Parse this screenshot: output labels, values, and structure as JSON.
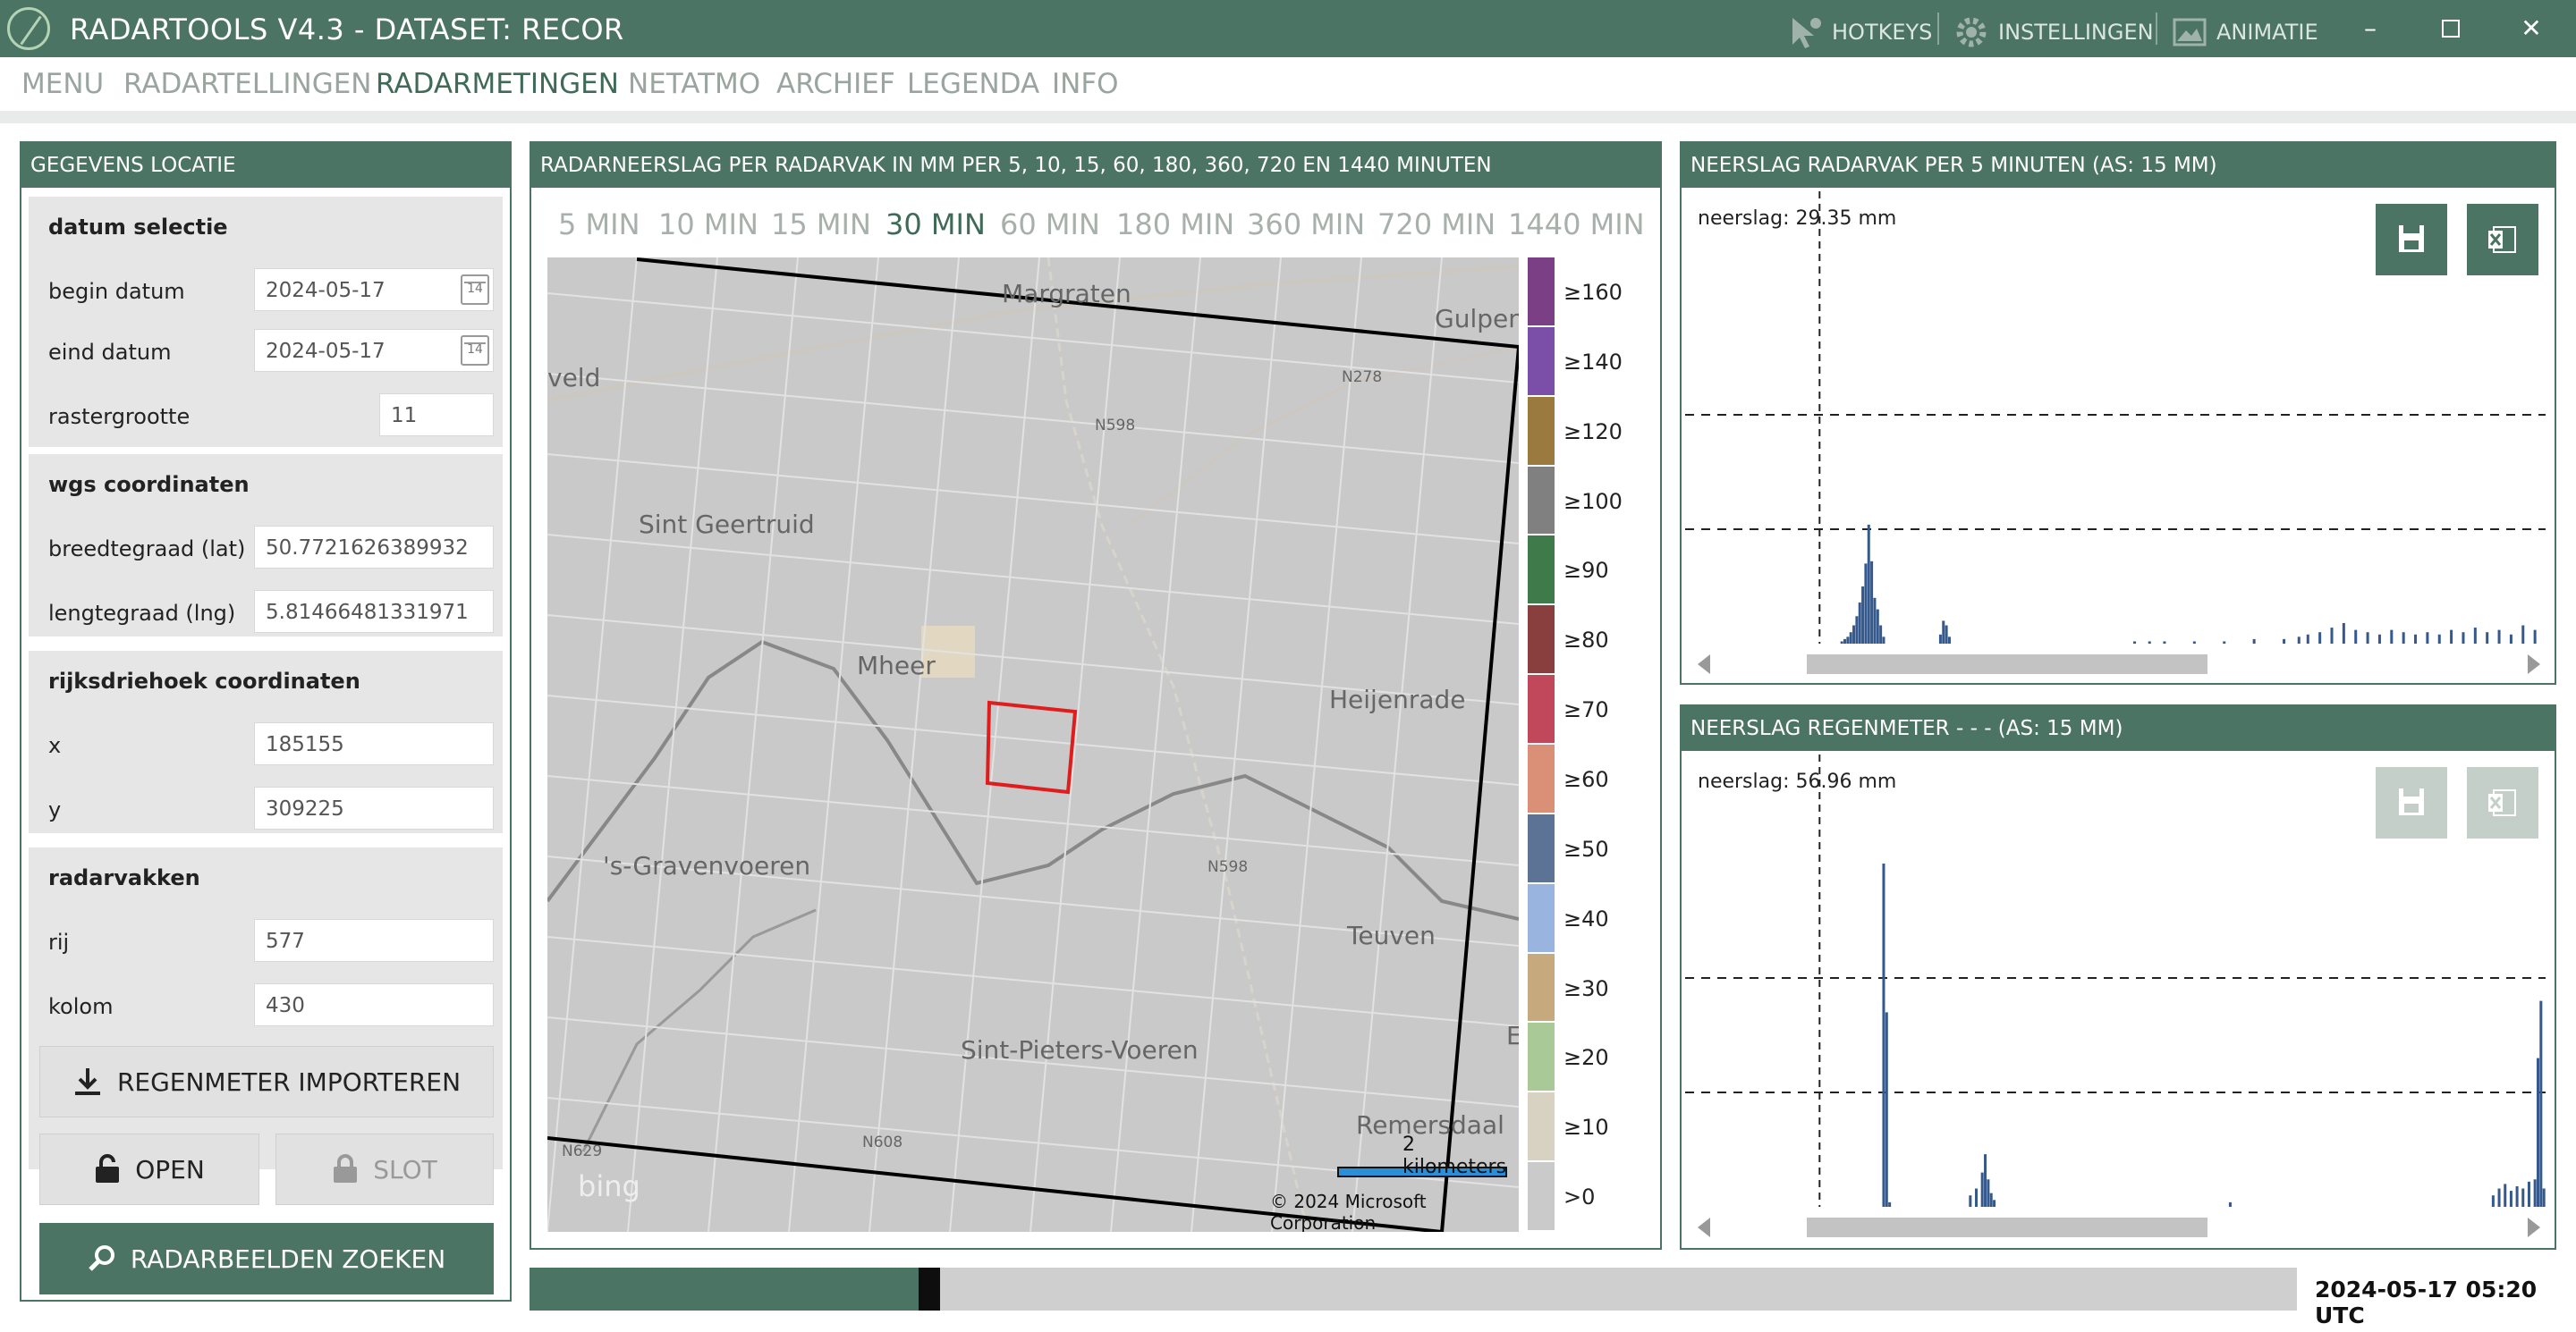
{
  "app": {
    "title": "RADARTOOLS V4.3 - DATASET: RECOR",
    "hotkeys_label": "HOTKEYS",
    "settings_label": "INSTELLINGEN",
    "animation_label": "ANIMATIE",
    "accent_color": "#4b7464"
  },
  "menu": {
    "items": [
      "MENU",
      "RADARTELLINGEN",
      "RADARMETINGEN",
      "NETATMO",
      "ARCHIEF",
      "LEGENDA",
      "INFO"
    ],
    "active": "RADARMETINGEN"
  },
  "location_panel": {
    "title": "GEGEVENS LOCATIE",
    "date_selection": {
      "title": "datum selectie",
      "begin_label": "begin datum",
      "begin_value": "2024-05-17",
      "end_label": "eind datum",
      "end_value": "2024-05-17",
      "grid_label": "rastergrootte",
      "grid_value": "11",
      "calendar_glyph": "14"
    },
    "wgs": {
      "title": "wgs coordinaten",
      "lat_label": "breedtegraad (lat)",
      "lat_value": "50.7721626389932",
      "lng_label": "lengtegraad (lng)",
      "lng_value": "5.81466481331971"
    },
    "rd": {
      "title": "rijksdriehoek coordinaten",
      "x_label": "x",
      "x_value": "185155",
      "y_label": "y",
      "y_value": "309225"
    },
    "radarvakken": {
      "title": "radarvakken",
      "row_label": "rij",
      "row_value": "577",
      "col_label": "kolom",
      "col_value": "430"
    },
    "buttons": {
      "import": "REGENMETER IMPORTEREN",
      "open": "OPEN",
      "lock": "SLOT",
      "search": "RADARBEELDEN ZOEKEN"
    }
  },
  "radar_panel": {
    "title": "RADARNEERSLAG PER RADARVAK IN MM PER 5, 10, 15, 60, 180, 360, 720 EN 1440 MINUTEN",
    "tabs": [
      "5 MIN",
      "10 MIN",
      "15 MIN",
      "30 MIN",
      "60 MIN",
      "180 MIN",
      "360 MIN",
      "720 MIN",
      "1440 MIN"
    ],
    "active_tab": "30 MIN",
    "map_labels": [
      "Margraten",
      "Gulpen",
      "veld",
      "Sint Geertruid",
      "Mheer",
      "Heijenrade",
      "'s-Gravenvoeren",
      "Teuven",
      "Sint-Pieters-Voeren",
      "Remersdaal",
      "N278",
      "N598",
      "N598",
      "N629",
      "N608",
      "E"
    ],
    "scale_label": "2 kilometers",
    "copyright": "© 2024 Microsoft Corporation",
    "bing": "bing",
    "legend": [
      {
        "label": "≥160",
        "color": "#7b3f86"
      },
      {
        "label": "≥140",
        "color": "#7b4fa8"
      },
      {
        "label": "≥120",
        "color": "#9a7a3f"
      },
      {
        "label": "≥100",
        "color": "#808080"
      },
      {
        "label": "≥90",
        "color": "#3f7a4a"
      },
      {
        "label": "≥80",
        "color": "#8a3f3f"
      },
      {
        "label": "≥70",
        "color": "#c0485a"
      },
      {
        "label": "≥60",
        "color": "#da9077"
      },
      {
        "label": "≥50",
        "color": "#5c7396"
      },
      {
        "label": "≥40",
        "color": "#9ab4e0"
      },
      {
        "label": "≥30",
        "color": "#c7a97e"
      },
      {
        "label": "≥20",
        "color": "#a9c996"
      },
      {
        "label": "≥10",
        "color": "#d8d2c2"
      },
      {
        "label": ">0",
        "color": "#cacaca"
      }
    ]
  },
  "chart_top": {
    "title": "NEERSLAG RADARVAK PER 5 MINUTEN (AS: 15 MM)",
    "neerslag": "neerslag: 29.35 mm"
  },
  "chart_bottom": {
    "title": "NEERSLAG REGENMETER -  -  -  (AS: 15 MM)",
    "neerslag": "neerslag: 56.96 mm"
  },
  "timeline": {
    "timestamp": "2024-05-17 05:20 UTC",
    "progress": 0.22
  },
  "chart_data": [
    {
      "type": "bar",
      "title": "NEERSLAG RADARVAK PER 5 MINUTEN (AS: 15 MM)",
      "x_range": [
        0,
        288
      ],
      "ylim": [
        0,
        15
      ],
      "grid": "dashed",
      "x": [
        52,
        53,
        54,
        55,
        56,
        57,
        58,
        59,
        60,
        61,
        62,
        63,
        64,
        65,
        66,
        85,
        86,
        87,
        88,
        150,
        155,
        160,
        170,
        180,
        190,
        200,
        205,
        208,
        212,
        216,
        220,
        224,
        228,
        232,
        236,
        240,
        244,
        248,
        252,
        256,
        260,
        264,
        268,
        272,
        276,
        280,
        284
      ],
      "values": [
        0.1,
        0.2,
        0.3,
        0.5,
        0.8,
        1.2,
        1.8,
        2.5,
        3.5,
        5.2,
        3.6,
        2.0,
        1.5,
        0.8,
        0.3,
        0.4,
        1.0,
        0.8,
        0.3,
        0.1,
        0.1,
        0.1,
        0.1,
        0.1,
        0.2,
        0.2,
        0.3,
        0.4,
        0.5,
        0.7,
        0.9,
        0.6,
        0.5,
        0.4,
        0.6,
        0.5,
        0.4,
        0.5,
        0.4,
        0.6,
        0.5,
        0.7,
        0.5,
        0.6,
        0.4,
        0.8,
        0.6
      ]
    },
    {
      "type": "bar",
      "title": "NEERSLAG REGENMETER -  -  -  (AS: 15 MM)",
      "x_range": [
        0,
        288
      ],
      "ylim": [
        0,
        15
      ],
      "grid": "dashed",
      "x": [
        66,
        67,
        68,
        95,
        97,
        99,
        100,
        101,
        102,
        103,
        182,
        270,
        272,
        274,
        276,
        278,
        280,
        282,
        284,
        285,
        286,
        287
      ],
      "values": [
        15.0,
        8.5,
        0.2,
        0.5,
        0.8,
        1.5,
        2.3,
        1.2,
        0.6,
        0.3,
        0.2,
        0.5,
        0.8,
        1.0,
        0.7,
        0.9,
        0.8,
        1.1,
        1.2,
        6.5,
        9.0,
        0.8
      ]
    }
  ]
}
